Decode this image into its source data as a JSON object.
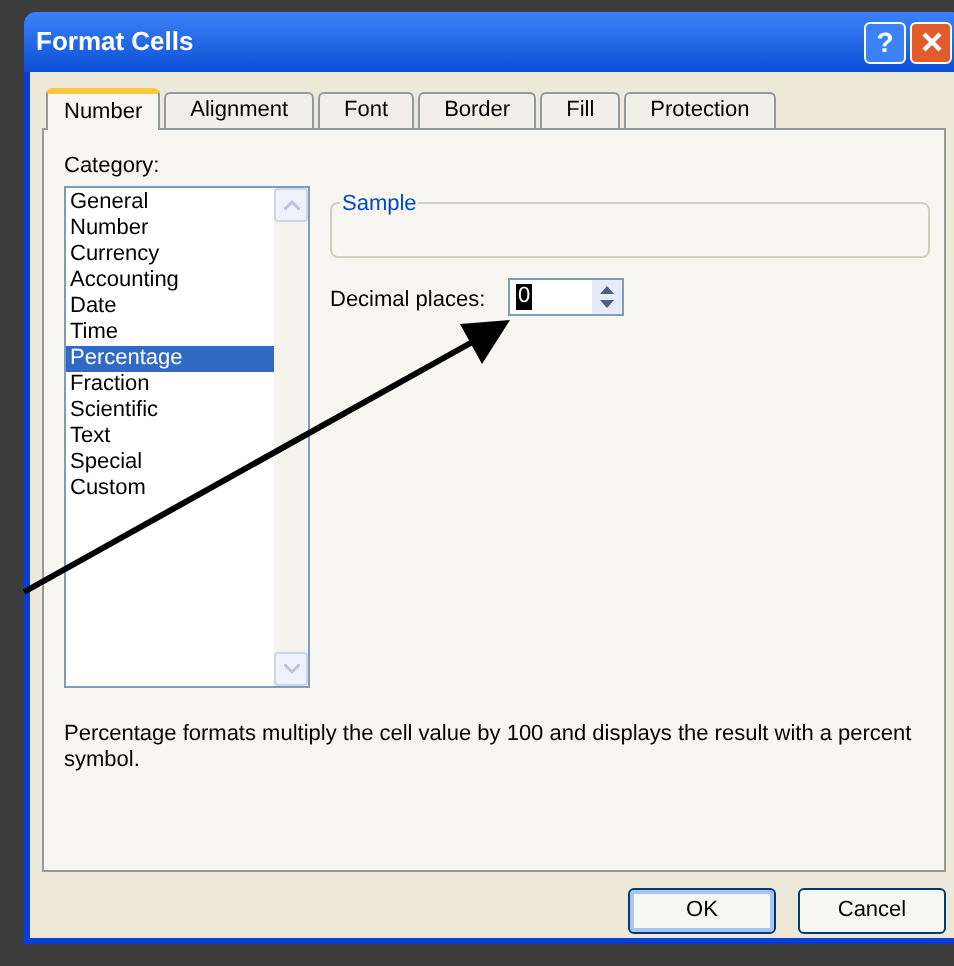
{
  "window": {
    "title": "Format Cells",
    "help_button": "?"
  },
  "tabs": [
    {
      "label": "Number",
      "selected": true
    },
    {
      "label": "Alignment",
      "selected": false
    },
    {
      "label": "Font",
      "selected": false
    },
    {
      "label": "Border",
      "selected": false
    },
    {
      "label": "Fill",
      "selected": false
    },
    {
      "label": "Protection",
      "selected": false
    }
  ],
  "category": {
    "label": "Category:",
    "items": [
      {
        "label": "General",
        "selected": false
      },
      {
        "label": "Number",
        "selected": false
      },
      {
        "label": "Currency",
        "selected": false
      },
      {
        "label": "Accounting",
        "selected": false
      },
      {
        "label": "Date",
        "selected": false
      },
      {
        "label": "Time",
        "selected": false
      },
      {
        "label": "Percentage",
        "selected": true
      },
      {
        "label": "Fraction",
        "selected": false
      },
      {
        "label": "Scientific",
        "selected": false
      },
      {
        "label": "Text",
        "selected": false
      },
      {
        "label": "Special",
        "selected": false
      },
      {
        "label": "Custom",
        "selected": false
      }
    ]
  },
  "sample": {
    "label": "Sample"
  },
  "decimal_places": {
    "label": "Decimal places:",
    "value": "0"
  },
  "description": "Percentage formats multiply the cell value by 100 and displays the result with a percent symbol.",
  "buttons": [
    "OK",
    "Cancel"
  ]
}
